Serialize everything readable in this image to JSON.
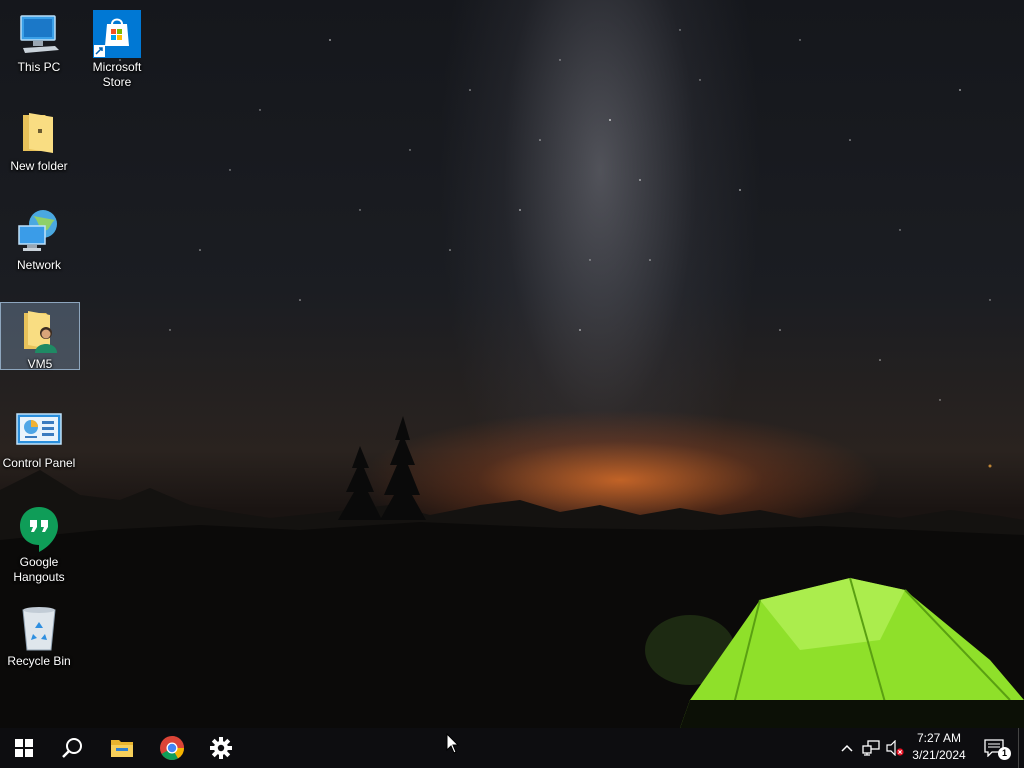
{
  "desktop": {
    "icons": [
      {
        "label": "This PC",
        "icon": "computer-icon"
      },
      {
        "label": "Microsoft Store",
        "icon": "store-icon"
      },
      {
        "label": "New folder",
        "icon": "folder-icon"
      },
      {
        "label": "Network",
        "icon": "network-icon"
      },
      {
        "label": "VM5",
        "icon": "user-folder-icon",
        "selected": true
      },
      {
        "label": "Control Panel",
        "icon": "control-panel-icon"
      },
      {
        "label": "Google Hangouts",
        "icon": "hangouts-icon"
      },
      {
        "label": "Recycle Bin",
        "icon": "recycle-bin-icon"
      }
    ]
  },
  "taskbar": {
    "pinned": [
      {
        "name": "Start",
        "icon": "windows-start-icon"
      },
      {
        "name": "Search",
        "icon": "search-icon"
      },
      {
        "name": "File Explorer",
        "icon": "file-explorer-icon"
      },
      {
        "name": "Google Chrome",
        "icon": "chrome-icon"
      },
      {
        "name": "Settings",
        "icon": "gear-icon"
      }
    ],
    "tray": {
      "time": "7:27 AM",
      "date": "3/21/2024",
      "notification_count": "1"
    }
  },
  "colors": {
    "taskbar_bg": "#0d0d10",
    "selection": "#8caac8",
    "store_blue": "#0078d4",
    "hangouts_green": "#0f9d58",
    "tent_green": "#8fe02a"
  }
}
